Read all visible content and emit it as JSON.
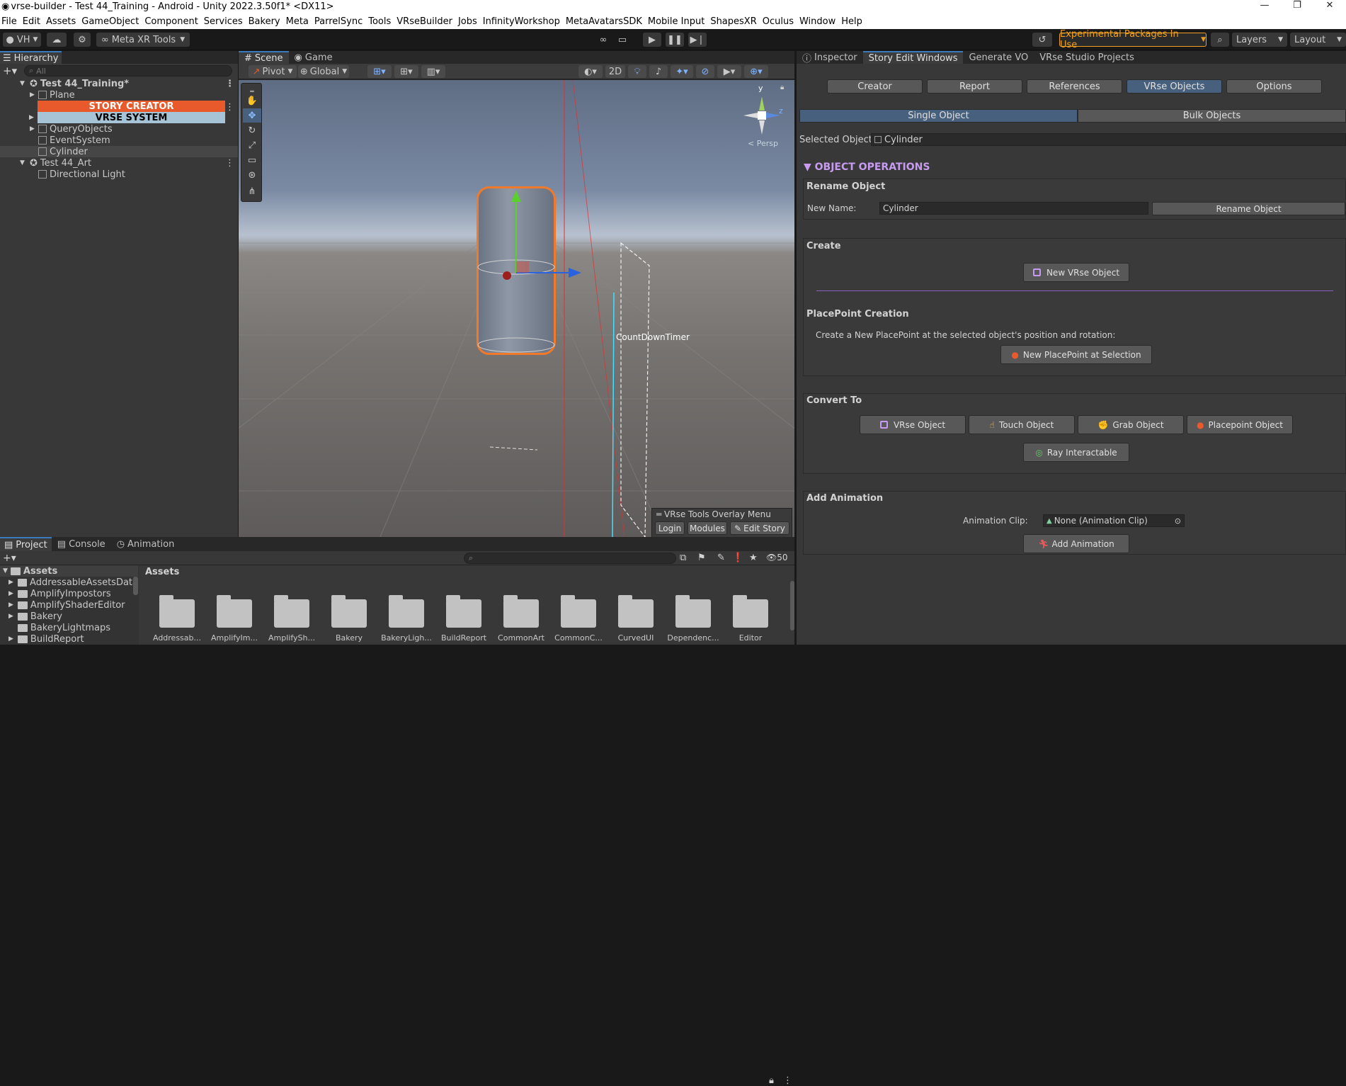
{
  "window": {
    "title": "vrse-builder - Test 44_Training - Android - Unity 2022.3.50f1* <DX11>"
  },
  "menu": [
    "File",
    "Edit",
    "Assets",
    "GameObject",
    "Component",
    "Services",
    "Bakery",
    "Meta",
    "ParrelSync",
    "Tools",
    "VRseBuilder",
    "Jobs",
    "InfinityWorkshop",
    "MetaAvatarsSDK",
    "Mobile Input",
    "ShapesXR",
    "Oculus",
    "Window",
    "Help"
  ],
  "toolbar": {
    "account": "VH",
    "meta_tools": "Meta XR Tools",
    "experimental": "Experimental Packages In Use",
    "layers": "Layers",
    "layout": "Layout"
  },
  "hierarchy": {
    "tab": "Hierarchy",
    "search_placeholder": "All",
    "items": [
      {
        "label": "Test 44_Training*"
      },
      {
        "label": "Plane"
      },
      {
        "label": "STORY CREATOR"
      },
      {
        "label": "VRSE SYSTEM"
      },
      {
        "label": "QueryObjects"
      },
      {
        "label": "EventSystem"
      },
      {
        "label": "Cylinder"
      },
      {
        "label": "Test 44_Art"
      },
      {
        "label": "Directional Light"
      }
    ]
  },
  "scene": {
    "tabs": [
      "Scene",
      "Game"
    ],
    "pivot": "Pivot",
    "global": "Global",
    "mode_2d": "2D",
    "persp": "Persp",
    "gizmo_y": "y",
    "gizmo_z": "z",
    "object_label": "CountDownTimer",
    "overlay": {
      "title": "VRse Tools Overlay Menu",
      "login": "Login",
      "modules": "Modules",
      "edit_story": "Edit Story"
    }
  },
  "inspector": {
    "tabs": [
      "Inspector",
      "Story Edit Windows",
      "Generate VO",
      "VRse Studio Projects"
    ],
    "top_buttons": [
      "Creator",
      "Report",
      "References",
      "VRse Objects",
      "Options"
    ],
    "mode_tabs": [
      "Single Object",
      "Bulk Objects"
    ],
    "selected_object_label": "Selected Object:",
    "selected_object_value": "Cylinder",
    "ops_header": "OBJECT OPERATIONS",
    "rename": {
      "title": "Rename Object",
      "label": "New Name:",
      "value": "Cylinder",
      "button": "Rename Object"
    },
    "create": {
      "title": "Create",
      "button": "New VRse Object"
    },
    "placepoint": {
      "title": "PlacePoint Creation",
      "desc": "Create a New PlacePoint at the selected object's position and rotation:",
      "button": "New PlacePoint at Selection"
    },
    "convert": {
      "title": "Convert To",
      "buttons": [
        "VRse Object",
        "Touch Object",
        "Grab Object",
        "Placepoint Object"
      ],
      "ray": "Ray Interactable"
    },
    "animation": {
      "title": "Add Animation",
      "clip_label": "Animation Clip:",
      "clip_value": "None (Animation Clip)",
      "button": "Add Animation"
    }
  },
  "project": {
    "tabs": [
      "Project",
      "Console",
      "Animation"
    ],
    "count": "50",
    "root": "Assets",
    "tree": [
      "AddressableAssetsData",
      "AmplifyImpostors",
      "AmplifyShaderEditor",
      "Bakery",
      "BakeryLightmaps",
      "BuildReport"
    ],
    "breadcrumb": "Assets",
    "folders": [
      "Addressab...",
      "AmplifyIm...",
      "AmplifySh...",
      "Bakery",
      "BakeryLigh...",
      "BuildReport",
      "CommonArt",
      "CommonC...",
      "CurvedUI",
      "Dependenc...",
      "Editor"
    ]
  },
  "colors": {
    "accent": "#3a79bb",
    "story_creator": "#e85a2b",
    "vrse_system": "#a7c4d6",
    "experimental": "#f0a020",
    "ops_header": "#c69bf0"
  }
}
